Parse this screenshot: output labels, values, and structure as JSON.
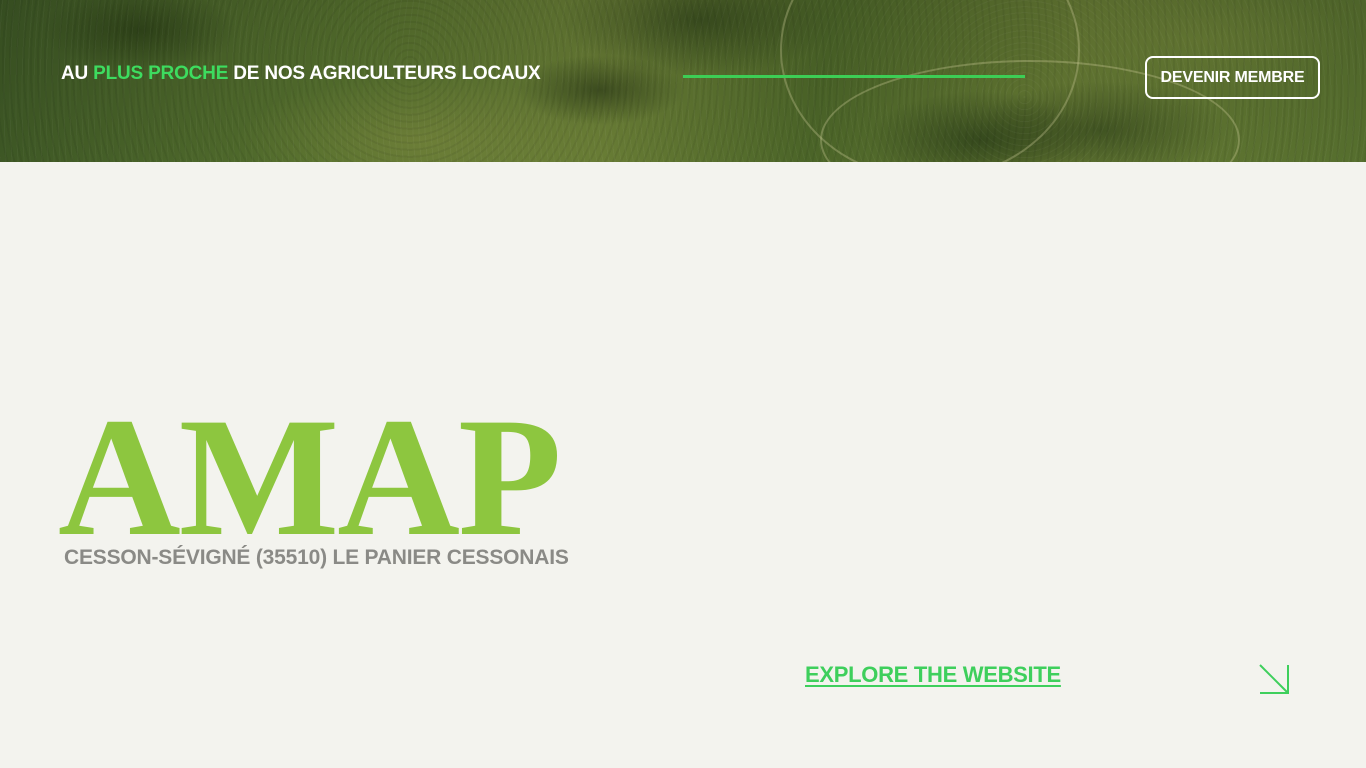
{
  "header": {
    "tagline_prefix": "AU ",
    "tagline_accent": "PLUS PROCHE",
    "tagline_suffix": " DE NOS AGRICULTEURS LOCAUX",
    "member_button": "DEVENIR MEMBRE"
  },
  "hero": {
    "title": "AMAP",
    "subtitle": "CESSON-SÉVIGNÉ (35510) LE PANIER CESSONAIS"
  },
  "cta": {
    "explore_label": "EXPLORE THE WEBSITE",
    "arrow_icon": "arrow-down-right-icon"
  },
  "colors": {
    "background": "#f3f3ee",
    "title_green": "#8dc63f",
    "accent_green": "#3ecf5c",
    "subtitle_gray": "#8a8a86"
  }
}
